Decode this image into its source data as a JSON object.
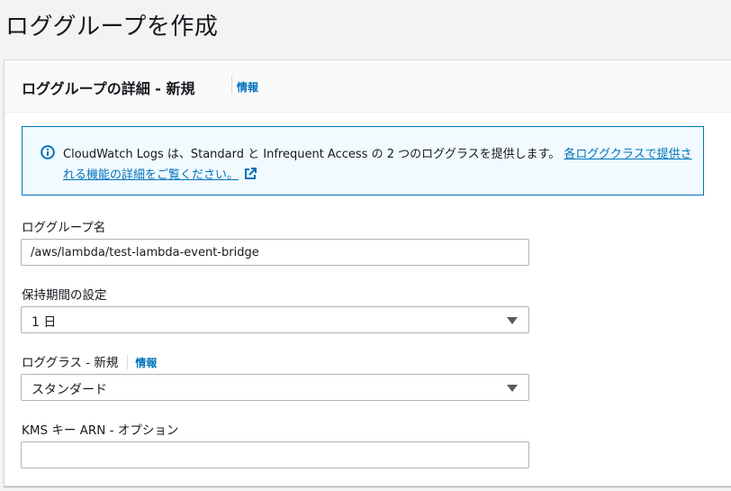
{
  "page": {
    "title": "ロググループを作成"
  },
  "panel": {
    "title": "ロググループの詳細 - 新規",
    "info_link": "情報"
  },
  "alert": {
    "text": "CloudWatch Logs は、Standard と Infrequent Access の 2 つのロググラスを提供します。 ",
    "link_text": "各ロググクラスで提供される機能の詳細をご覧ください。",
    "icon": "info-circle-icon",
    "link_icon": "external-link-icon",
    "accent_color": "#0073bb"
  },
  "fields": {
    "log_group_name": {
      "label": "ロググループ名",
      "value": "/aws/lambda/test-lambda-event-bridge"
    },
    "retention": {
      "label": "保持期間の設定",
      "value": "1 日"
    },
    "log_class": {
      "label": "ロググラス - 新規",
      "info_link": "情報",
      "value": "スタンダード"
    },
    "kms": {
      "label": "KMS キー ARN - オプション",
      "value": ""
    }
  }
}
